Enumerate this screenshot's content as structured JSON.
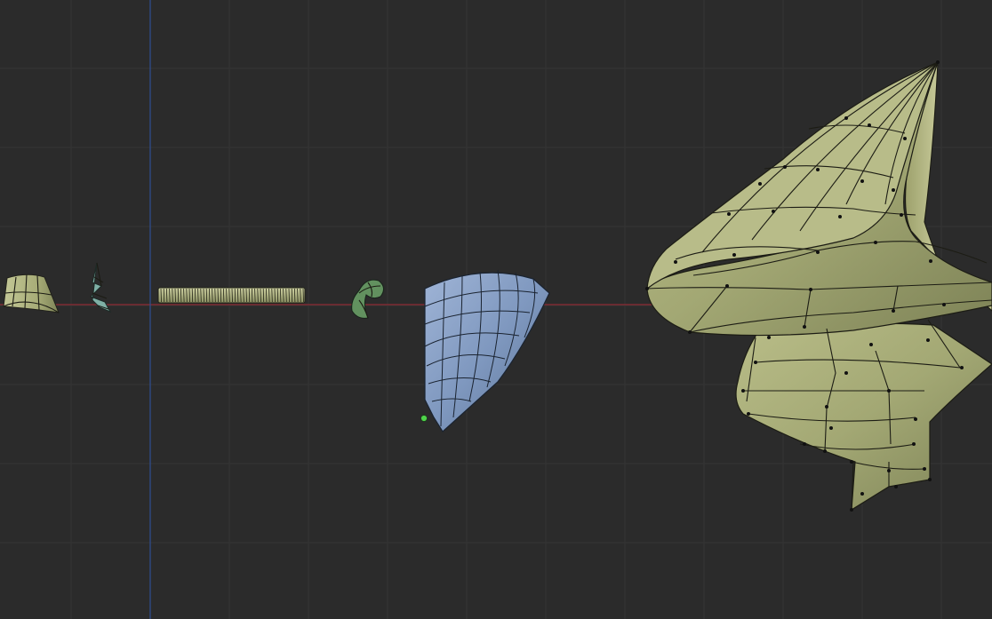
{
  "app": "3D Viewport",
  "viewport": {
    "background": "#2b2b2b",
    "grid_color": "#353535",
    "x_axis_color": "#8e2a33",
    "y_axis_color": "#2f4f93"
  },
  "objects": [
    {
      "name": "small-bell-shape",
      "color": "#a8ad78",
      "selected": false
    },
    {
      "name": "small-cone-spiral",
      "color": "#7fb0a6",
      "selected": false
    },
    {
      "name": "flat-ridged-cylinder",
      "color": "#b4b889",
      "selected": false
    },
    {
      "name": "small-twisted-leaf",
      "color": "#62915f",
      "selected": false
    },
    {
      "name": "blue-curved-sheet",
      "color": "#7f98bf",
      "selected": true
    },
    {
      "name": "large-spiral-cone",
      "color": "#c4c694",
      "selected": false
    }
  ],
  "origin_marker": {
    "color": "#4fd34a"
  }
}
